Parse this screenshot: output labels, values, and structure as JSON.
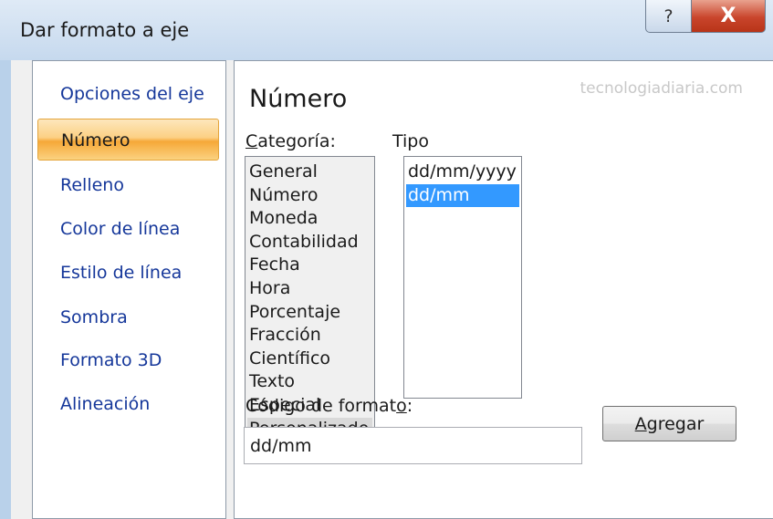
{
  "window": {
    "title": "Dar formato a eje",
    "help_glyph": "?",
    "close_glyph": "X"
  },
  "nav": {
    "items": [
      {
        "label": "Opciones del eje",
        "selected": false
      },
      {
        "label": "Número",
        "selected": true
      },
      {
        "label": "Relleno",
        "selected": false
      },
      {
        "label": "Color de línea",
        "selected": false
      },
      {
        "label": "Estilo de línea",
        "selected": false
      },
      {
        "label": "Sombra",
        "selected": false
      },
      {
        "label": "Formato 3D",
        "selected": false
      },
      {
        "label": "Alineación",
        "selected": false
      }
    ]
  },
  "content": {
    "section_title": "Número",
    "watermark": "tecnologiadiaria.com",
    "category_label_first": "C",
    "category_label_rest": "ategoría:",
    "type_label": "Tipo",
    "categories": [
      "General",
      "Número",
      "Moneda",
      "Contabilidad",
      "Fecha",
      "Hora",
      "Porcentaje",
      "Fracción",
      "Científico",
      "Texto",
      "Especial",
      "Personalizado"
    ],
    "selected_category": "Personalizado",
    "types": [
      "dd/mm/yyyy",
      "dd/mm"
    ],
    "selected_type": "dd/mm",
    "format_code_label_pre": "Código de format",
    "format_code_label_key": "o",
    "format_code_label_post": ":",
    "format_code_value": "dd/mm",
    "add_button_key": "A",
    "add_button_rest": "gregar"
  },
  "colors": {
    "nav_text": "#15379a",
    "selection_blue": "#3399ff",
    "nav_selected_orange": "#f6a838",
    "watermark": "#c8c8c8"
  }
}
